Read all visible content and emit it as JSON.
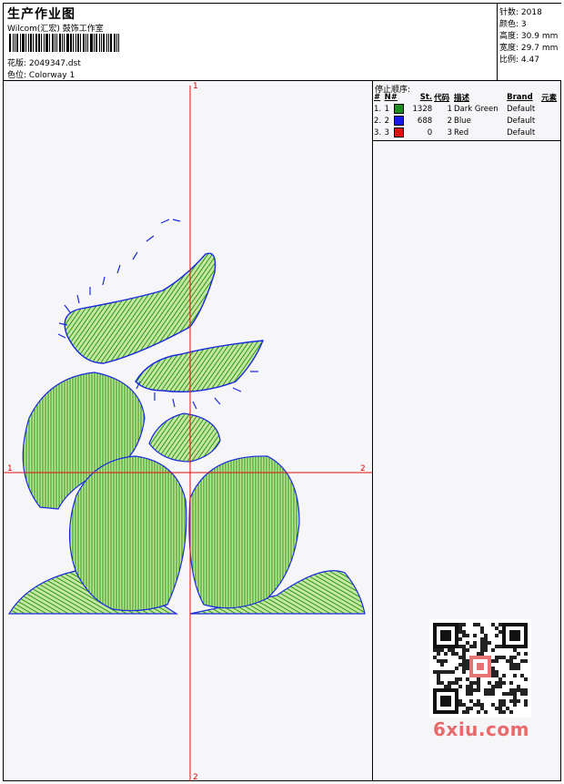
{
  "header": {
    "title": "生产作业图",
    "subtitle": "Wilcom(汇宏) 鼓饰工作室",
    "design_label": "花版:",
    "design_file": "2049347.dst",
    "colorway_label": "色位:",
    "colorway": "Colorway 1"
  },
  "stats": [
    {
      "label": "针数:",
      "value": "2018"
    },
    {
      "label": "颜色:",
      "value": "3"
    },
    {
      "label": "高度:",
      "value": "30.9 mm"
    },
    {
      "label": "宽度:",
      "value": "29.7 mm"
    },
    {
      "label": "比例:",
      "value": "4.47"
    }
  ],
  "stop_sequence": {
    "title": "停止顺序:",
    "columns": [
      "#",
      "N#",
      "St.",
      "代码",
      "描述",
      "Brand",
      "元素"
    ],
    "rows": [
      {
        "idx": "1.",
        "n": "1",
        "color": "#1e8c1e",
        "stitches": "1328",
        "code": "1",
        "desc": "Dark Green",
        "brand": "Default"
      },
      {
        "idx": "2.",
        "n": "2",
        "color": "#1a1adc",
        "stitches": "688",
        "code": "2",
        "desc": "Blue",
        "brand": "Default"
      },
      {
        "idx": "3.",
        "n": "3",
        "color": "#e01010",
        "stitches": "0",
        "code": "3",
        "desc": "Red",
        "brand": "Default"
      }
    ]
  },
  "axis_labels": {
    "top": "1",
    "bottom": "2",
    "left": "1",
    "right": "2"
  },
  "watermark": "6xiu.com",
  "colors": {
    "stitch_green": "#2a9a10",
    "outline_blue": "#1a2ae0",
    "axis_red": "#dd1111"
  }
}
